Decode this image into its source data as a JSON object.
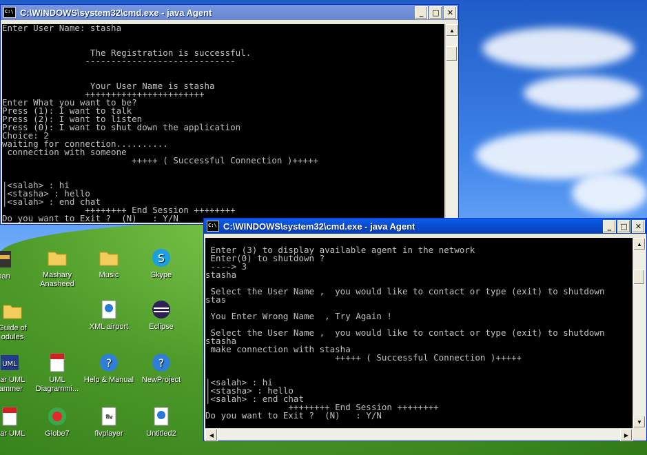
{
  "colors": {
    "titlebar_active": "#0a4fd5",
    "titlebar_inactive": "#6f8fd7",
    "console_bg": "#000000",
    "console_fg": "#c0c0c0"
  },
  "window_back": {
    "title": "C:\\WINDOWS\\system32\\cmd.exe - java Agent",
    "buttons": {
      "minimize": "_",
      "maximize": "□",
      "close": "✕"
    },
    "lines": [
      "Enter User Name: stasha",
      "",
      "",
      "                 The Registration is successful.",
      "                -----------------------------",
      "",
      "",
      "                 Your User Name is stasha",
      "                +++++++++++++++++++++++",
      "Enter What you want to be?",
      "Press (1): I want to talk",
      "Press (2): I want to listen",
      "Press (0): I want to shut down the application",
      "Choice: 2",
      "waiting for connection..........",
      " connection with someone",
      "                         +++++ ( Successful Connection )+++++",
      "",
      "",
      "|<salah> : hi",
      "|<stasha> : hello",
      "|<salah> : end chat",
      "                ++++++++ End Session ++++++++",
      "Do you want to Exit ?  (N)   : Y/N"
    ]
  },
  "window_front": {
    "title": "C:\\WINDOWS\\system32\\cmd.exe - java Agent",
    "buttons": {
      "minimize": "_",
      "maximize": "□",
      "close": "✕"
    },
    "lines": [
      "",
      " Enter (3) to display available agent in the network",
      " Enter(0) to shutdown ?",
      " ----> 3",
      "stasha",
      "",
      " Select the User Name ,  you would like to contact or type (exit) to shutdown",
      "stas",
      "",
      " You Enter Wrong Name  , Try Again !",
      "",
      " Select the User Name ,  you would like to contact or type (exit) to shutdown",
      "stasha",
      " make connection with stasha",
      "                         +++++ ( Successful Connection )+++++",
      "",
      "",
      "|<salah> : hi",
      "|<stasha> : hello",
      "|<salah> : end chat",
      "                ++++++++ End Session ++++++++",
      "Do you want to Exit ?  (N)   : Y/N"
    ]
  },
  "desktop_icons": [
    {
      "label": "than",
      "icon": "app-icon"
    },
    {
      "label": "Mashary Anasheed",
      "icon": "folder-icon"
    },
    {
      "label": "Music",
      "icon": "folder-icon"
    },
    {
      "label": "Skype",
      "icon": "skype-icon"
    },
    {
      "label": "Guide of odules",
      "icon": "folder-icon"
    },
    {
      "label": "XML airport",
      "icon": "xml-document-icon"
    },
    {
      "label": "Eclipse",
      "icon": "eclipse-icon"
    },
    {
      "label": "star UML rammer",
      "icon": "uml-icon"
    },
    {
      "label": "UML Diagrammi...",
      "icon": "pdf-icon"
    },
    {
      "label": "Help & Manual",
      "icon": "help-manual-icon"
    },
    {
      "label": "NewProject",
      "icon": "help-manual-icon"
    },
    {
      "label": "star UML",
      "icon": "pdf-icon"
    },
    {
      "label": "Globe7",
      "icon": "globe7-icon"
    },
    {
      "label": "flvplayer",
      "icon": "flvplayer-icon"
    },
    {
      "label": "Untitled2",
      "icon": "xml-document-icon"
    }
  ]
}
